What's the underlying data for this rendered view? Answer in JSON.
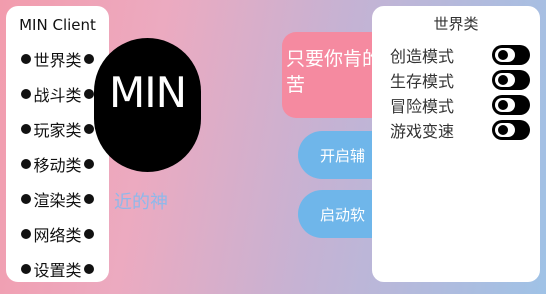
{
  "sidebar": {
    "title": "MIN Client",
    "items": [
      {
        "label": "世界类"
      },
      {
        "label": "战斗类"
      },
      {
        "label": "玩家类"
      },
      {
        "label": "移动类"
      },
      {
        "label": "渲染类"
      },
      {
        "label": "网络类"
      },
      {
        "label": "设置类"
      }
    ]
  },
  "logo": {
    "text": "MIN"
  },
  "slogan": "近的神",
  "card": {
    "text": "只要你肯的苦"
  },
  "buttons": {
    "enable": "开启辅",
    "launch": "启动软"
  },
  "panel": {
    "title": "世界类",
    "rows": [
      {
        "label": "创造模式",
        "enabled": false
      },
      {
        "label": "生存模式",
        "enabled": false
      },
      {
        "label": "冒险模式",
        "enabled": false
      },
      {
        "label": "游戏变速",
        "enabled": false
      }
    ]
  },
  "colors": {
    "card_pink": "#f58aa0",
    "button_blue": "#6fb6ea",
    "slogan_blue": "#8fb8ea"
  }
}
